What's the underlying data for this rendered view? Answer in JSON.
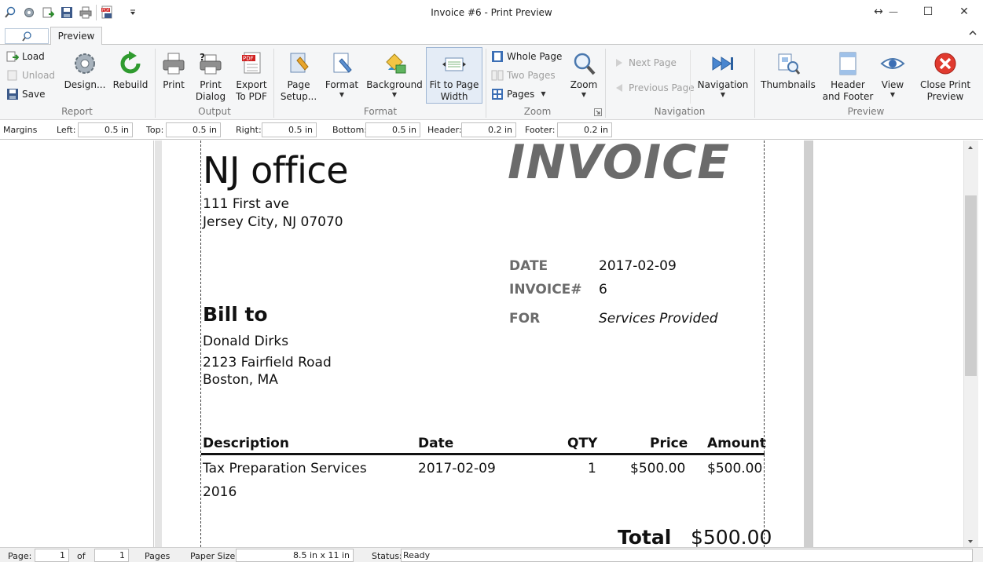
{
  "window": {
    "title": "Invoice #6 - Print Preview",
    "controls": {
      "resize_glyph": "↔",
      "minimize": "—",
      "maximize": "☐",
      "close": "✕"
    }
  },
  "quick_access": [
    "search-icon",
    "gear-icon",
    "load-icon",
    "save-icon",
    "print-icon",
    "pdf-icon",
    "customize-dropdown-icon"
  ],
  "tabs": {
    "active": "Preview"
  },
  "ribbon": {
    "report": {
      "label": "Report",
      "load": "Load",
      "unload": "Unload",
      "save": "Save",
      "design": "Design...",
      "rebuild": "Rebuild"
    },
    "output": {
      "label": "Output",
      "print": "Print",
      "print_dialog_1": "Print",
      "print_dialog_2": "Dialog",
      "export_1": "Export",
      "export_2": "To PDF"
    },
    "format": {
      "label": "Format",
      "page_setup_1": "Page",
      "page_setup_2": "Setup...",
      "format": "Format",
      "background": "Background",
      "fit_1": "Fit to Page",
      "fit_2": "Width"
    },
    "zoom": {
      "label": "Zoom",
      "whole_page": "Whole Page",
      "two_pages": "Two Pages",
      "pages": "Pages",
      "zoom": "Zoom"
    },
    "navigation": {
      "label": "Navigation",
      "next_page": "Next Page",
      "previous_page": "Previous Page",
      "navigation": "Navigation"
    },
    "preview": {
      "label": "Preview",
      "thumbnails": "Thumbnails",
      "header_footer_1": "Header",
      "header_footer_2": "and Footer",
      "view": "View",
      "close_1": "Close Print",
      "close_2": "Preview"
    }
  },
  "margins": {
    "label": "Margins",
    "left_label": "Left:",
    "left": "0.5 in",
    "top_label": "Top:",
    "top": "0.5 in",
    "right_label": "Right:",
    "right": "0.5 in",
    "bottom_label": "Bottom:",
    "bottom": "0.5 in",
    "header_label": "Header:",
    "header": "0.2 in",
    "footer_label": "Footer:",
    "footer": "0.2 in"
  },
  "invoice": {
    "company": "NJ office",
    "title": "INVOICE",
    "address_1": "111 First ave",
    "address_2": "Jersey City, NJ 07070",
    "date_label": "DATE",
    "date": "2017-02-09",
    "number_label": "INVOICE#",
    "number": "6",
    "for_label": "FOR",
    "for": "Services Provided",
    "bill_to_label": "Bill to",
    "bill_name": "Donald Dirks",
    "bill_street": "2123 Fairfield Road",
    "bill_city": "Boston, MA",
    "columns": {
      "description": "Description",
      "date": "Date",
      "qty": "QTY",
      "price": "Price",
      "amount": "Amount"
    },
    "items": [
      {
        "description_1": "Tax Preparation Services",
        "description_2": "2016",
        "date": "2017-02-09",
        "qty": "1",
        "price": "$500.00",
        "amount": "$500.00"
      }
    ],
    "total_label": "Total",
    "total": "$500.00"
  },
  "status": {
    "page_label": "Page:",
    "page": "1",
    "of_label": "of",
    "of": "1",
    "pages_label": "Pages",
    "paper_label": "Paper Size:",
    "paper": "8.5 in x 11 in",
    "status_label": "Status:",
    "status": "Ready"
  }
}
